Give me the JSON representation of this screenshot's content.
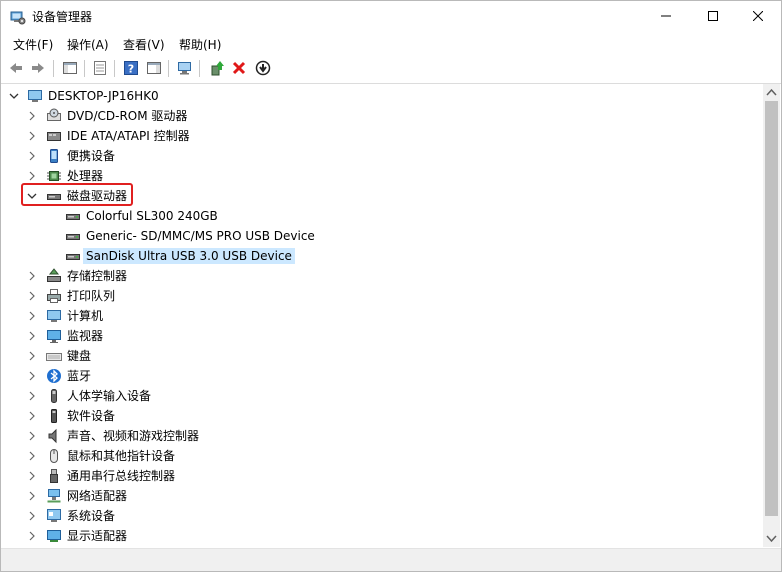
{
  "window": {
    "title": "设备管理器"
  },
  "menu": [
    "文件(F)",
    "操作(A)",
    "查看(V)",
    "帮助(H)"
  ],
  "tree": {
    "root": "DESKTOP-JP16HK0",
    "items": [
      {
        "label": "DVD/CD-ROM 驱动器",
        "icon": "dvd-drive-icon"
      },
      {
        "label": "IDE ATA/ATAPI 控制器",
        "icon": "ide-controller-icon"
      },
      {
        "label": "便携设备",
        "icon": "portable-device-icon"
      },
      {
        "label": "处理器",
        "icon": "processor-icon"
      },
      {
        "label": "磁盘驱动器",
        "icon": "disk-drive-icon",
        "expanded": true,
        "children": [
          {
            "label": "Colorful SL300 240GB",
            "icon": "disk-icon"
          },
          {
            "label": "Generic- SD/MMC/MS PRO USB Device",
            "icon": "disk-icon"
          },
          {
            "label": "SanDisk Ultra USB 3.0 USB Device",
            "icon": "disk-icon",
            "selected": true
          }
        ]
      },
      {
        "label": "存储控制器",
        "icon": "storage-controller-icon"
      },
      {
        "label": "打印队列",
        "icon": "printer-icon"
      },
      {
        "label": "计算机",
        "icon": "computer-icon"
      },
      {
        "label": "监视器",
        "icon": "monitor-icon"
      },
      {
        "label": "键盘",
        "icon": "keyboard-icon"
      },
      {
        "label": "蓝牙",
        "icon": "bluetooth-icon"
      },
      {
        "label": "人体学输入设备",
        "icon": "hid-icon"
      },
      {
        "label": "软件设备",
        "icon": "software-device-icon"
      },
      {
        "label": "声音、视频和游戏控制器",
        "icon": "audio-icon"
      },
      {
        "label": "鼠标和其他指针设备",
        "icon": "mouse-icon"
      },
      {
        "label": "通用串行总线控制器",
        "icon": "usb-icon"
      },
      {
        "label": "网络适配器",
        "icon": "network-adapter-icon"
      },
      {
        "label": "系统设备",
        "icon": "system-device-icon"
      },
      {
        "label": "显示适配器",
        "icon": "display-adapter-icon"
      }
    ]
  },
  "colors": {
    "selection": "#cce8ff",
    "annotation": "#e02020"
  }
}
